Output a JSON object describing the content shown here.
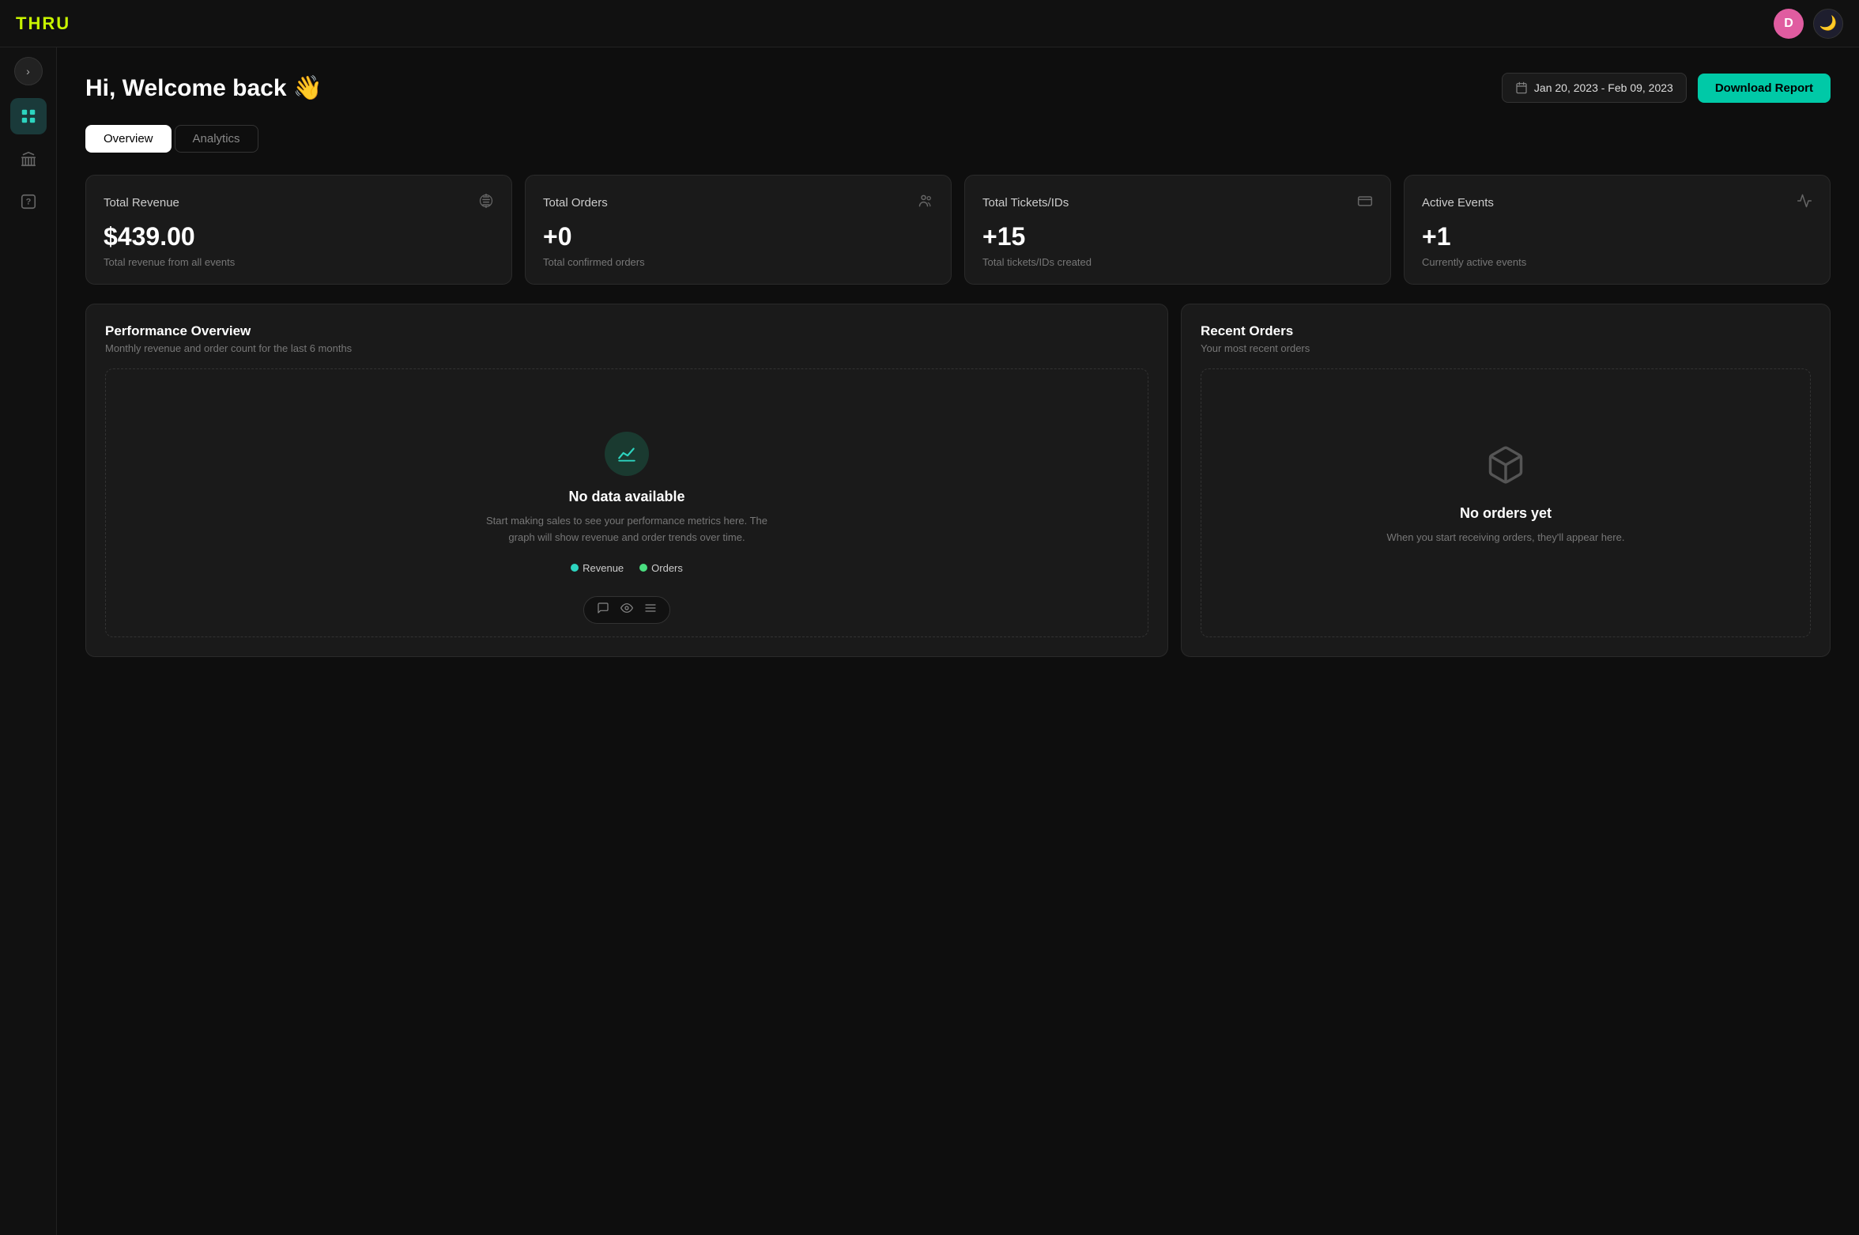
{
  "topnav": {
    "logo": "THRU",
    "avatar_initial": "D",
    "theme_toggle_icon": "🌙"
  },
  "sidebar": {
    "toggle_icon": "›",
    "items": [
      {
        "id": "dashboard",
        "icon": "⊞",
        "active": true
      },
      {
        "id": "bank",
        "icon": "🏛",
        "active": false
      },
      {
        "id": "question",
        "icon": "?",
        "active": false
      }
    ]
  },
  "header": {
    "welcome_text": "Hi, Welcome back",
    "welcome_emoji": "👋",
    "date_range": "Jan 20, 2023 - Feb 09, 2023",
    "download_btn": "Download Report"
  },
  "tabs": [
    {
      "id": "overview",
      "label": "Overview",
      "active": true
    },
    {
      "id": "analytics",
      "label": "Analytics",
      "active": false
    }
  ],
  "stat_cards": [
    {
      "id": "total-revenue",
      "label": "Total Revenue",
      "value": "$439.00",
      "desc": "Total revenue from all events",
      "icon": "$"
    },
    {
      "id": "total-orders",
      "label": "Total Orders",
      "value": "+0",
      "desc": "Total confirmed orders",
      "icon": "👥"
    },
    {
      "id": "total-tickets",
      "label": "Total Tickets/IDs",
      "value": "+15",
      "desc": "Total tickets/IDs created",
      "icon": "▬"
    },
    {
      "id": "active-events",
      "label": "Active Events",
      "value": "+1",
      "desc": "Currently active events",
      "icon": "∿"
    }
  ],
  "performance_panel": {
    "title": "Performance Overview",
    "subtitle": "Monthly revenue and order count for the last 6 months",
    "empty_title": "No data available",
    "empty_desc": "Start making sales to see your performance metrics here. The graph will show revenue and order trends over time.",
    "legend": [
      {
        "label": "Revenue",
        "color": "#2dd4bf"
      },
      {
        "label": "Orders",
        "color": "#4ade80"
      }
    ]
  },
  "recent_orders_panel": {
    "title": "Recent Orders",
    "subtitle": "Your most recent orders",
    "empty_title": "No orders yet",
    "empty_desc": "When you start receiving orders, they'll appear here."
  },
  "chart_toolbar": {
    "icons": [
      "💬",
      "👁",
      "≡"
    ]
  }
}
